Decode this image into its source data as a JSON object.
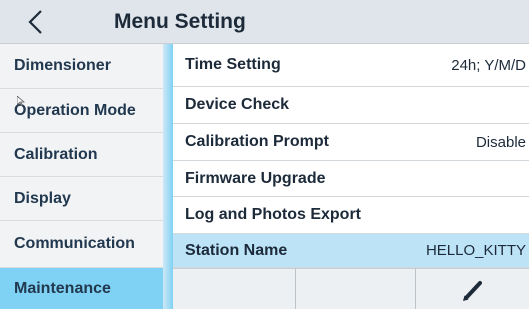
{
  "header": {
    "back_icon": "chevron-left-icon",
    "title": "Menu Setting"
  },
  "sidebar": {
    "items": [
      {
        "label": "Dimensioner",
        "active": false
      },
      {
        "label": "Operation Mode",
        "active": false
      },
      {
        "label": "Calibration",
        "active": false
      },
      {
        "label": "Display",
        "active": false
      },
      {
        "label": "Communication",
        "active": false
      },
      {
        "label": "Maintenance",
        "active": true
      }
    ]
  },
  "main": {
    "rows": [
      {
        "label": "Time Setting",
        "value": "24h; Y/M/D",
        "selected": false
      },
      {
        "label": "Device Check",
        "value": "",
        "selected": false
      },
      {
        "label": "Calibration Prompt",
        "value": "Disable",
        "selected": false
      },
      {
        "label": "Firmware Upgrade",
        "value": "",
        "selected": false
      },
      {
        "label": "Log and Photos Export",
        "value": "",
        "selected": false
      },
      {
        "label": "Station Name",
        "value": "HELLO_KITTY",
        "selected": true
      }
    ]
  },
  "toolbar": {
    "buttons": [
      "empty",
      "empty",
      "pencil-edit-icon"
    ]
  },
  "colors": {
    "header_bg": "#dfe5ea",
    "sidebar_active": "#7fd2f4",
    "row_selected": "#bde3f7",
    "text": "#1c2a3a"
  }
}
